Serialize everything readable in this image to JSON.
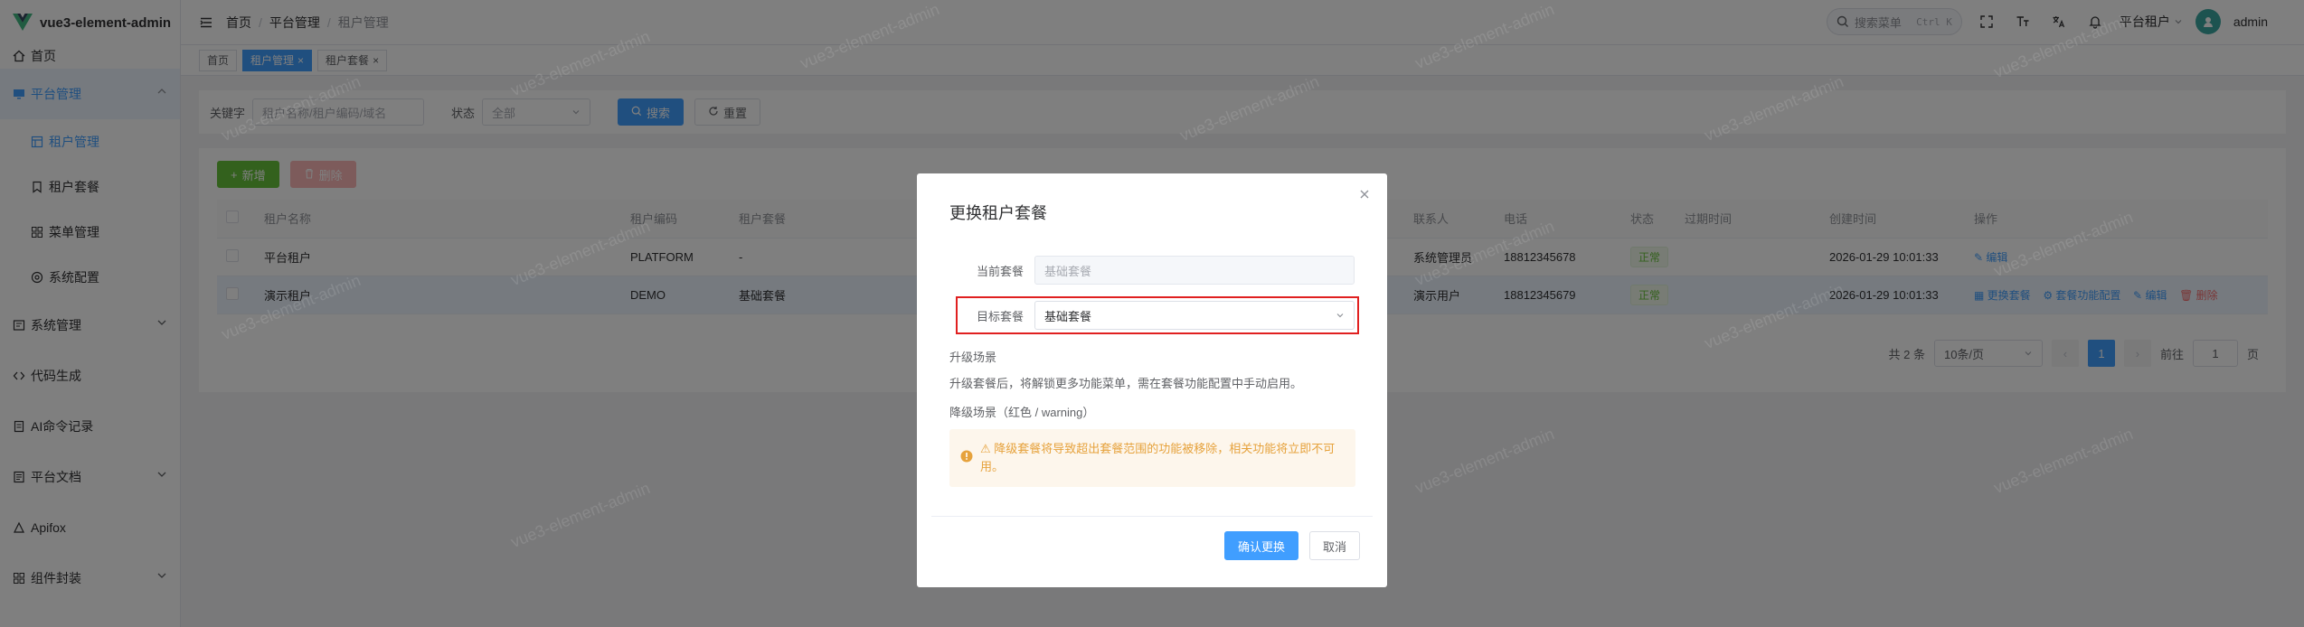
{
  "app": {
    "name": "vue3-element-admin"
  },
  "sidebar": {
    "items": [
      {
        "label": "首页"
      },
      {
        "label": "平台管理"
      },
      {
        "label": "租户管理"
      },
      {
        "label": "租户套餐"
      },
      {
        "label": "菜单管理"
      },
      {
        "label": "系统配置"
      },
      {
        "label": "系统管理"
      },
      {
        "label": "代码生成"
      },
      {
        "label": "AI命令记录"
      },
      {
        "label": "平台文档"
      },
      {
        "label": "Apifox"
      },
      {
        "label": "组件封装"
      }
    ]
  },
  "header": {
    "breadcrumbs": [
      "首页",
      "平台管理",
      "租户管理"
    ],
    "search_placeholder": "搜索菜单",
    "search_shortcut": "Ctrl K",
    "tenant": "平台租户",
    "username": "admin"
  },
  "tags": [
    "首页",
    "租户管理",
    "租户套餐"
  ],
  "filter": {
    "keyword_label": "关键字",
    "keyword_placeholder": "租户名称/租户编码/域名",
    "status_label": "状态",
    "status_value": "全部",
    "search_button": "搜索",
    "reset_button": "重置"
  },
  "toolbar": {
    "add_button": "新增",
    "delete_button": "删除"
  },
  "table": {
    "columns": [
      "租户名称",
      "租户编码",
      "租户套餐",
      "联系人",
      "电话",
      "状态",
      "过期时间",
      "创建时间",
      "操作"
    ],
    "rows": [
      {
        "name": "平台租户",
        "code": "PLATFORM",
        "package": "-",
        "contact": "系统管理员",
        "phone": "18812345678",
        "status": "正常",
        "expire": "",
        "created": "2026-01-29 10:01:33",
        "ops": [
          "编辑"
        ]
      },
      {
        "name": "演示租户",
        "code": "DEMO",
        "package": "基础套餐",
        "contact": "演示用户",
        "phone": "18812345679",
        "status": "正常",
        "expire": "",
        "created": "2026-01-29 10:01:33",
        "ops": [
          "更换套餐",
          "套餐功能配置",
          "编辑",
          "删除"
        ]
      }
    ]
  },
  "pagination": {
    "total": "共 2 条",
    "page_size": "10条/页",
    "current": "1",
    "goto_label": "前往",
    "goto_value": "1",
    "page_unit": "页"
  },
  "watermark": "vue3-element-admin",
  "modal": {
    "title": "更换租户套餐",
    "current_label": "当前套餐",
    "current_value": "基础套餐",
    "target_label": "目标套餐",
    "target_value": "基础套餐",
    "upgrade_title": "升级场景",
    "upgrade_desc": "升级套餐后，将解锁更多功能菜单，需在套餐功能配置中手动启用。",
    "downgrade_title": "降级场景（红色 / warning）",
    "warning_text": "⚠ 降级套餐将导致超出套餐范围的功能被移除，相关功能将立即不可用。",
    "confirm_button": "确认更换",
    "cancel_button": "取消"
  },
  "colors": {
    "primary": "#409eff",
    "success": "#67c23a",
    "warning": "#e6a23c",
    "danger": "#f56c6c",
    "highlight": "#e02020"
  }
}
